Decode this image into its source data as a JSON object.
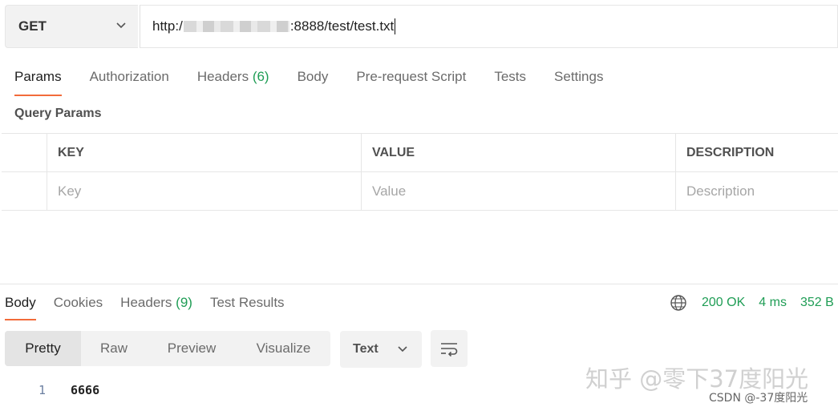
{
  "request": {
    "method": "GET",
    "url_prefix": "http:/",
    "url_suffix": ":8888/test/test.txt"
  },
  "request_tabs": [
    {
      "label": "Params"
    },
    {
      "label": "Authorization"
    },
    {
      "label": "Headers",
      "count": "(6)"
    },
    {
      "label": "Body"
    },
    {
      "label": "Pre-request Script"
    },
    {
      "label": "Tests"
    },
    {
      "label": "Settings"
    }
  ],
  "query_params": {
    "title": "Query Params",
    "columns": [
      "KEY",
      "VALUE",
      "DESCRIPTION"
    ],
    "placeholders": [
      "Key",
      "Value",
      "Description"
    ]
  },
  "response_tabs": [
    {
      "label": "Body"
    },
    {
      "label": "Cookies"
    },
    {
      "label": "Headers",
      "count": "(9)"
    },
    {
      "label": "Test Results"
    }
  ],
  "response_status": {
    "status": "200 OK",
    "time": "4 ms",
    "size": "352 B"
  },
  "view_modes": [
    "Pretty",
    "Raw",
    "Preview",
    "Visualize"
  ],
  "format": "Text",
  "body_lines": [
    {
      "number": "1",
      "text": "6666"
    }
  ],
  "watermarks": {
    "zhihu": "知乎 @零下37度阳光",
    "csdn": "CSDN @-37度阳光"
  },
  "colors": {
    "accent": "#f26b3a",
    "success": "#1f9d55"
  },
  "icons": {
    "method_dropdown": "chevron-down-icon",
    "globe": "globe-icon",
    "format_dropdown": "chevron-down-icon",
    "wrap": "wrap-lines-icon"
  }
}
